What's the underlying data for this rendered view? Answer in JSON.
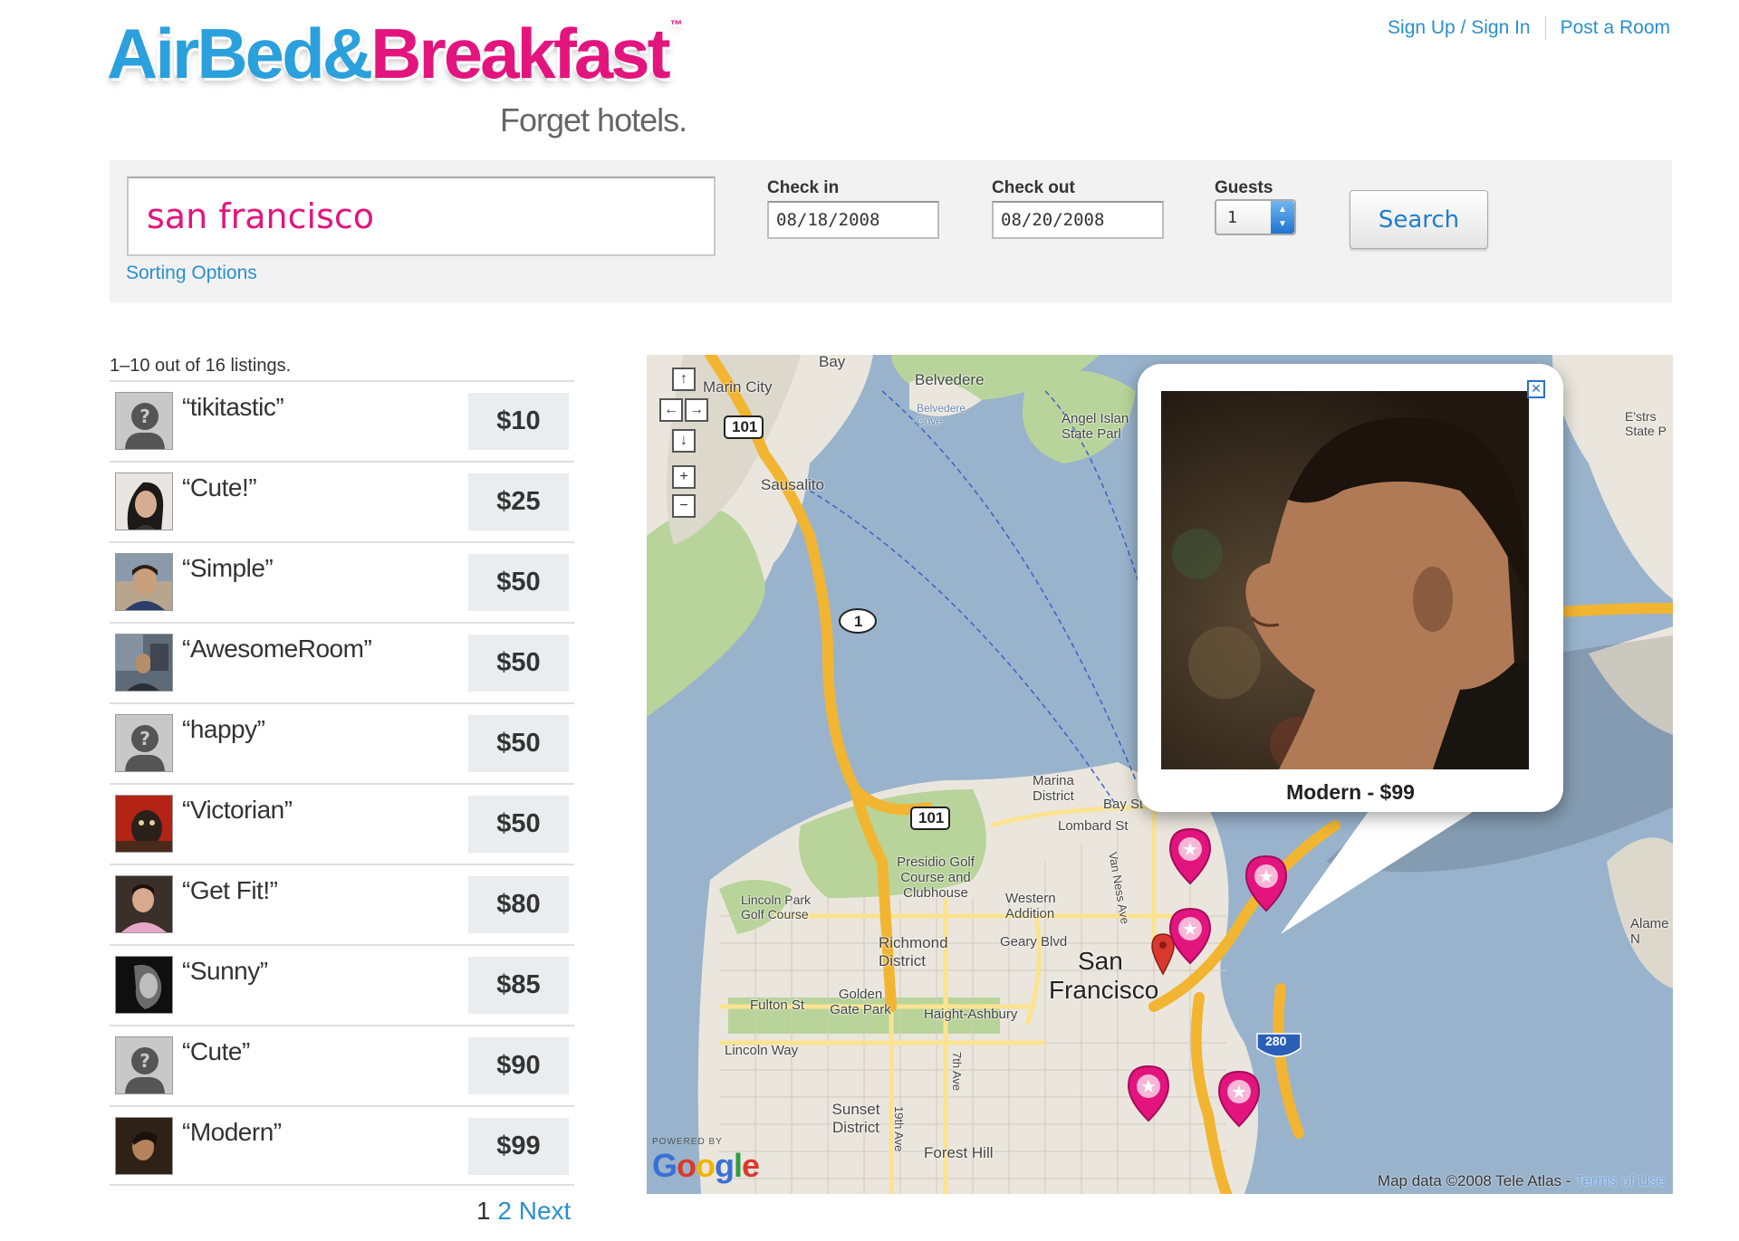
{
  "brand": {
    "logo_part1": "AirBed",
    "logo_part2": "&",
    "logo_part3": "Breakfast",
    "trademark": "™",
    "tagline": "Forget hotels."
  },
  "top_links": {
    "signup": "Sign Up / Sign In",
    "post_room": "Post a Room"
  },
  "search": {
    "location_value": "san francisco",
    "sorting_link": "Sorting Options",
    "checkin_label": "Check in",
    "checkin_value": "08/18/2008",
    "checkout_label": "Check out",
    "checkout_value": "08/20/2008",
    "guests_label": "Guests",
    "guests_value": "1",
    "button_label": "Search"
  },
  "results": {
    "count_text": "1–10 out of 16 listings.",
    "listings": [
      {
        "name": "“tikitastic”",
        "price": "$10",
        "avatar": "placeholder"
      },
      {
        "name": "“Cute!”",
        "price": "$25",
        "avatar": "photo"
      },
      {
        "name": "“Simple”",
        "price": "$50",
        "avatar": "photo"
      },
      {
        "name": "“AwesomeRoom”",
        "price": "$50",
        "avatar": "photo"
      },
      {
        "name": "“happy”",
        "price": "$50",
        "avatar": "placeholder"
      },
      {
        "name": "“Victorian”",
        "price": "$50",
        "avatar": "photo"
      },
      {
        "name": "“Get Fit!”",
        "price": "$80",
        "avatar": "photo"
      },
      {
        "name": "“Sunny”",
        "price": "$85",
        "avatar": "photo"
      },
      {
        "name": "“Cute”",
        "price": "$90",
        "avatar": "placeholder"
      },
      {
        "name": "“Modern”",
        "price": "$99",
        "avatar": "photo"
      }
    ],
    "pagination": {
      "current": "1",
      "next_page": "2",
      "next_label": "Next"
    }
  },
  "map": {
    "popup_caption": "Modern - $99",
    "labels": {
      "bay": "Bay",
      "marin_city": "Marin City",
      "belvedere": "Belvedere",
      "belvedere_cove": "Belvedere Cove",
      "angel_island": "Angel Islan State Parl",
      "sausalito": "Sausalito",
      "marina": "Marina District",
      "bay_st": "Bay St",
      "lombard": "Lombard St",
      "presidio": "Presidio Golf Course and Clubhouse",
      "western_addition": "Western Addition",
      "lincoln_park": "Lincoln Park Golf Course",
      "richmond": "Richmond District",
      "geary": "Geary Blvd",
      "sf1": "San",
      "sf2": "Francisco",
      "fulton": "Fulton St",
      "ggpark": "Golden Gate Park",
      "haight": "Haight-Ashbury",
      "lincoln_way": "Lincoln Way",
      "sunset": "Sunset District",
      "forest_hill": "Forest Hill",
      "alameda": "Alame N",
      "east_state": "E'strs State P",
      "hwy101": "101",
      "hwy1": "1",
      "i280": "280",
      "van_ness": "Van Ness Ave",
      "nineteenth": "19th Ave",
      "seventh": "7th Ave"
    },
    "powered_by": "POWERED BY",
    "google": "Google",
    "copyright": "Map data ©2008 Tele Atlas - ",
    "terms": "Terms of Use"
  },
  "colors": {
    "brand_blue": "#2aa0dd",
    "brand_pink": "#e3147e",
    "link_blue": "#2a8fd0",
    "water": "#99b3cc",
    "land": "#eae6dd",
    "park": "#b8d49a",
    "highway": "#f2b531"
  }
}
